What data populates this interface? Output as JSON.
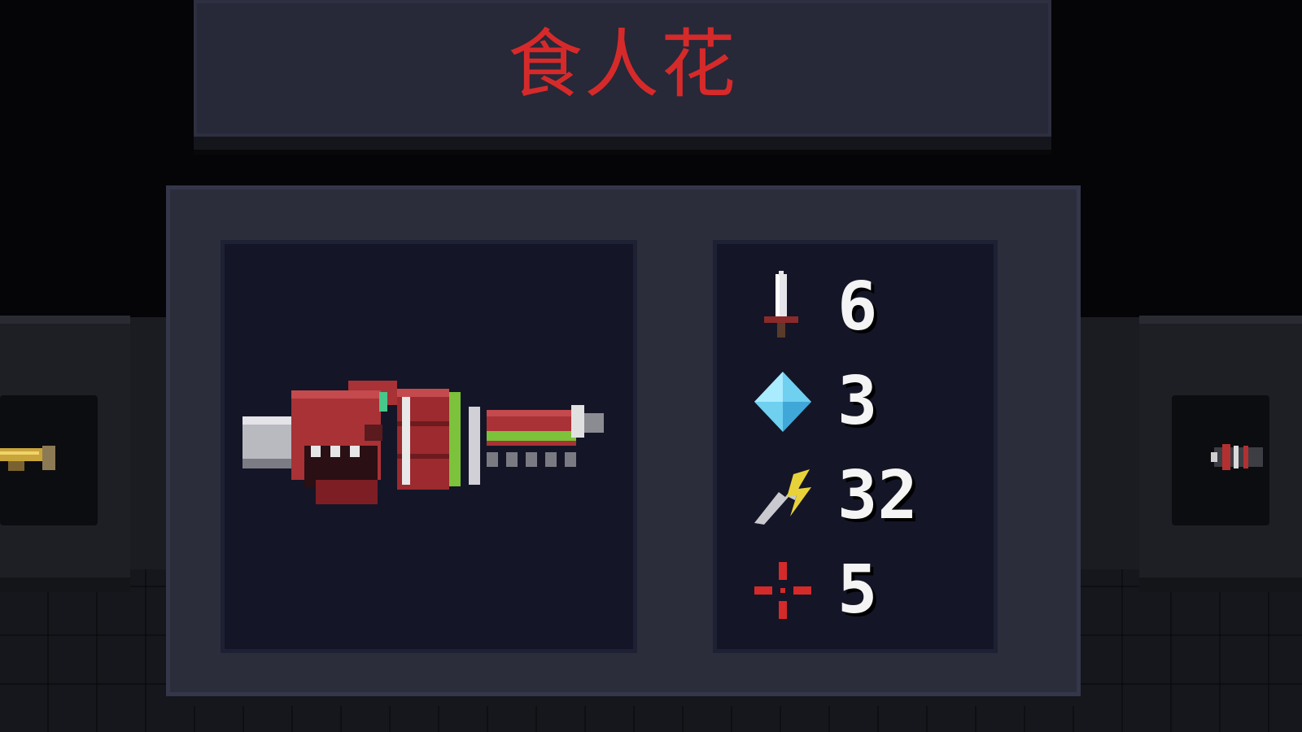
{
  "weapon": {
    "name": "食人花",
    "name_color": "#d62a2a"
  },
  "stats": [
    {
      "icon": "sword-icon",
      "value": "6"
    },
    {
      "icon": "energy-crystal-icon",
      "value": "3"
    },
    {
      "icon": "lightning-icon",
      "value": "32"
    },
    {
      "icon": "crosshair-icon",
      "value": "5"
    }
  ],
  "side_items": {
    "left": "golden-gun-icon",
    "right": "red-gun-icon"
  }
}
